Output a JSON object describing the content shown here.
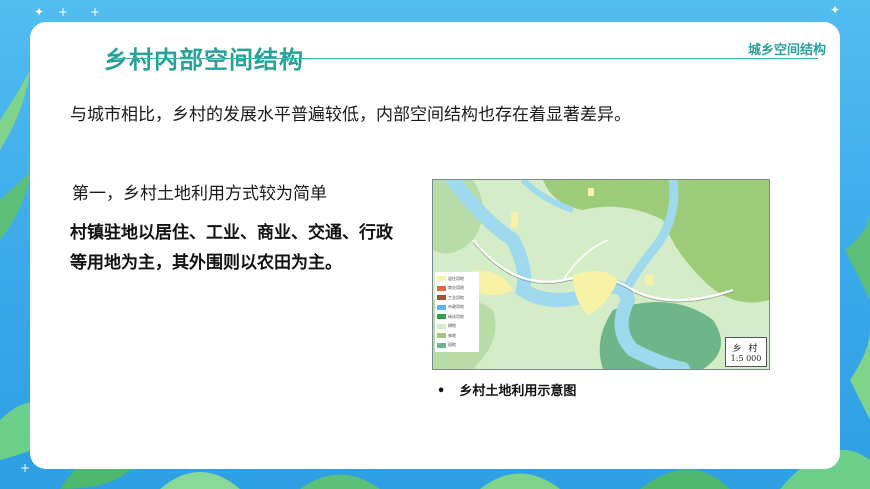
{
  "header": {
    "title": "乡村内部空间结构",
    "section_tag": "城乡空间结构"
  },
  "content": {
    "intro": "与城市相比，乡村的发展水平普遍较低，内部空间结构也存在着显著差异。",
    "heading": "第一，乡村土地利用方式较为简单",
    "body": "村镇驻地以居住、工业、商业、交通、行政等用地为主，其外围则以农田为主。"
  },
  "map": {
    "legend": [
      {
        "label": "居住用地",
        "color": "#f8f2a6"
      },
      {
        "label": "商业用地",
        "color": "#e8663a"
      },
      {
        "label": "工业用地",
        "color": "#a0522d"
      },
      {
        "label": "市政用地",
        "color": "#58b8e6"
      },
      {
        "label": "绿化用地",
        "color": "#2e9e4a"
      },
      {
        "label": "耕地",
        "color": "#d5ecc8"
      },
      {
        "label": "林地",
        "color": "#9ccc7a"
      },
      {
        "label": "园地",
        "color": "#6fb58a"
      }
    ],
    "scale_name": "乡 村",
    "scale_ratio": "1:5 000",
    "caption_bullet": "•",
    "caption": "乡村土地利用示意图"
  },
  "colors": {
    "background": "#3aa9ea",
    "title": "#2aa198",
    "river": "#9fd9ee"
  }
}
